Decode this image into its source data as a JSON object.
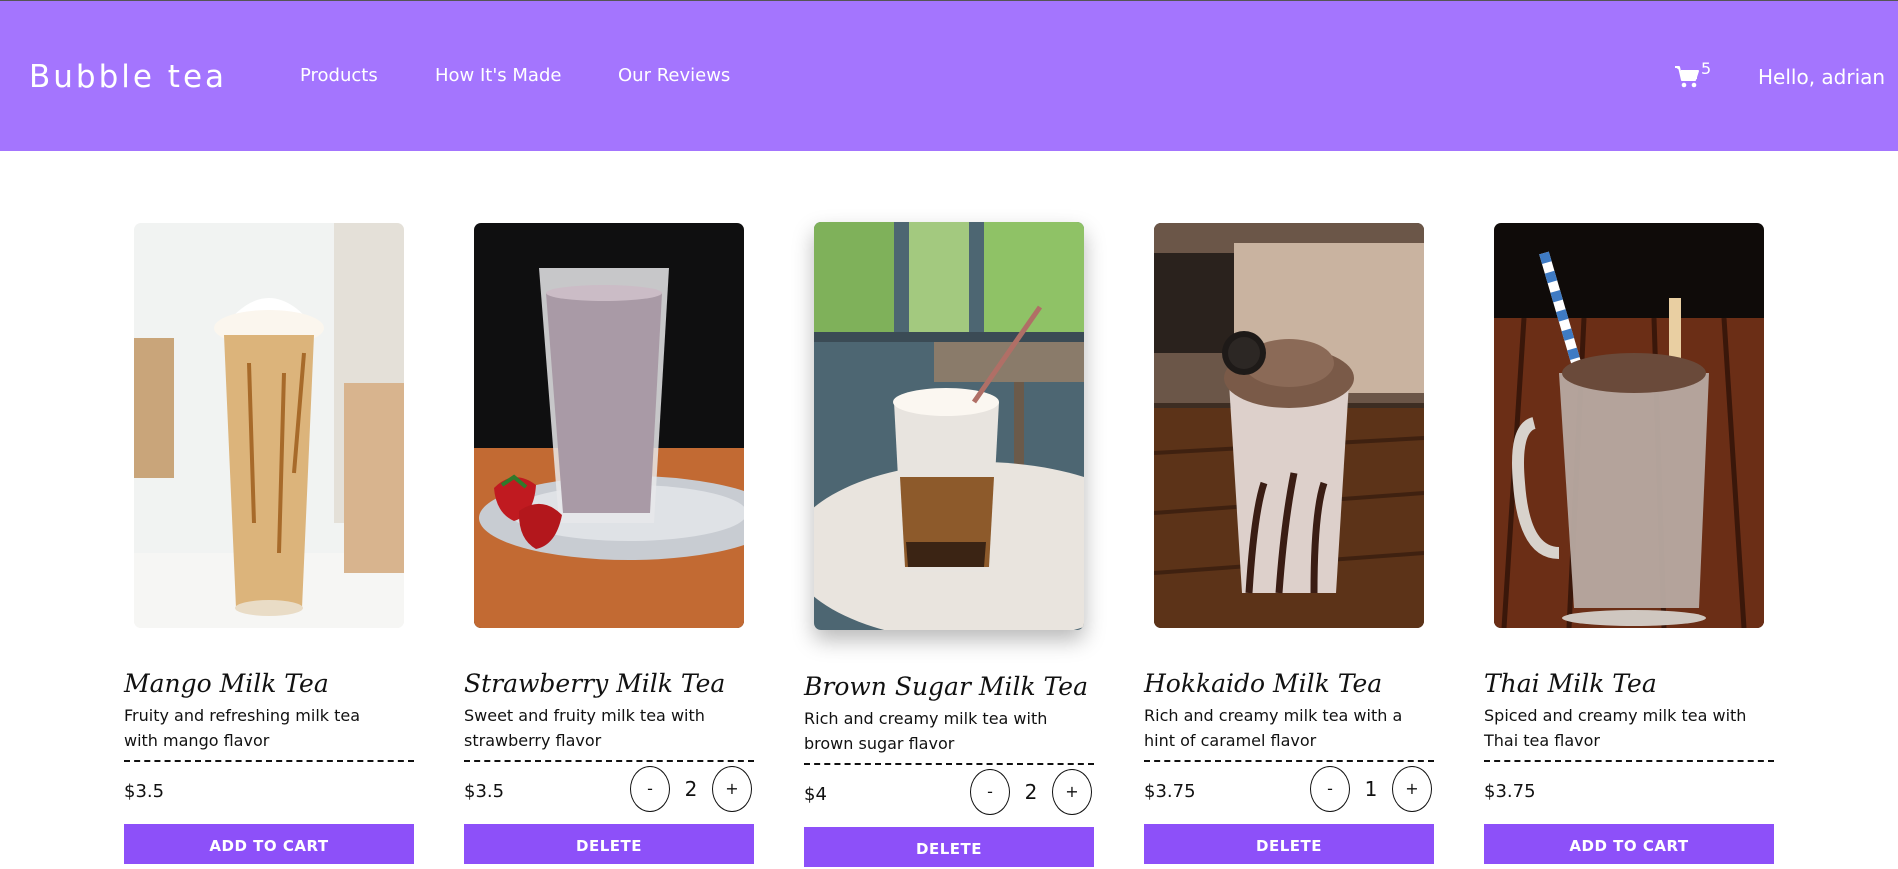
{
  "header": {
    "brand": "Bubble tea",
    "nav": [
      "Products",
      "How It's Made",
      "Our Reviews"
    ],
    "cart_count": "5",
    "greeting": "Hello, adrian"
  },
  "colors": {
    "header_bg": "#a475fe",
    "button_bg": "#8d50f9"
  },
  "products": [
    {
      "name": "Mango Milk Tea",
      "description": "Fruity and refreshing milk tea with mango flavor",
      "price": "$3.5",
      "action": "ADD TO CART",
      "in_cart": false
    },
    {
      "name": "Strawberry Milk Tea",
      "description": "Sweet and fruity milk tea with strawberry flavor",
      "price": "$3.5",
      "action": "DELETE",
      "in_cart": true,
      "minus": "-",
      "qty": "2",
      "plus": "+"
    },
    {
      "name": "Brown Sugar Milk Tea",
      "description": "Rich and creamy milk tea with brown sugar flavor",
      "price": "$4",
      "action": "DELETE",
      "in_cart": true,
      "minus": "-",
      "qty": "2",
      "plus": "+"
    },
    {
      "name": "Hokkaido Milk Tea",
      "description": "Rich and creamy milk tea with a hint of caramel flavor",
      "price": "$3.75",
      "action": "DELETE",
      "in_cart": true,
      "minus": "-",
      "qty": "1",
      "plus": "+"
    },
    {
      "name": "Thai Milk Tea",
      "description": "Spiced and creamy milk tea with Thai tea flavor",
      "price": "$3.75",
      "action": "ADD TO CART",
      "in_cart": false
    }
  ]
}
